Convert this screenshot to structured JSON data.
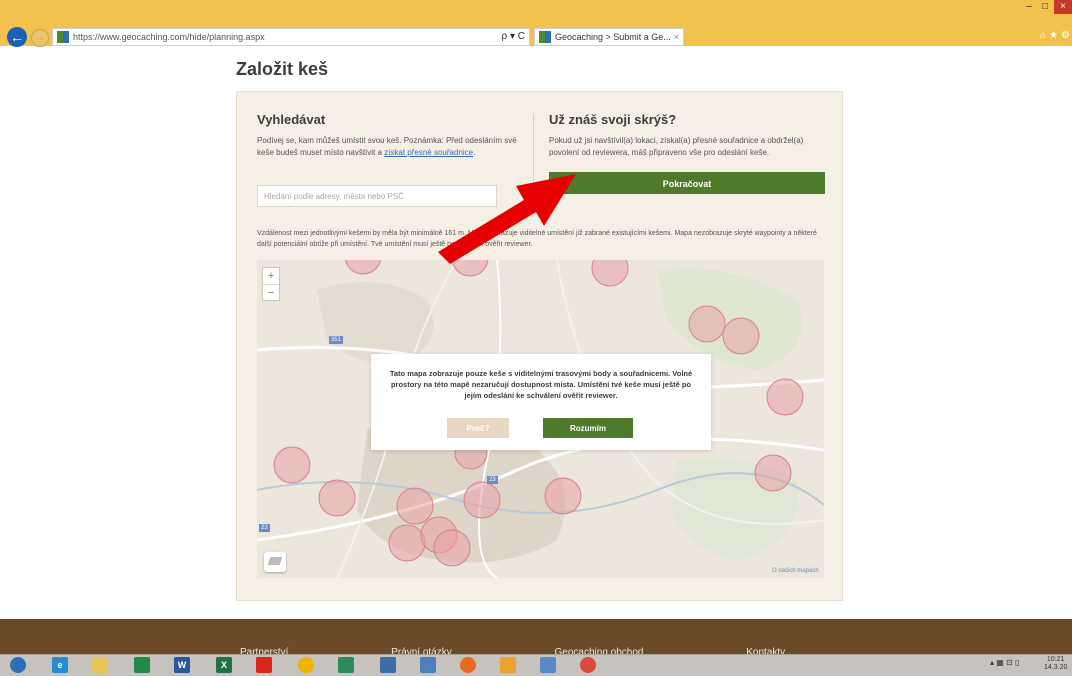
{
  "browser": {
    "url": "https://www.geocaching.com/hide/planning.aspx",
    "tab_title": "Geocaching > Submit a Ge...",
    "tab_close": "×",
    "address_tools": "ρ ▾ C",
    "window_min": "–",
    "window_max": "□",
    "window_close": "×"
  },
  "page": {
    "title": "Založit keš"
  },
  "left_column": {
    "heading": "Vyhledávat",
    "text_before_link": "Podívej se, kam můžeš umístit svou keš. Poznámka: Před odesláním své keše budeš muset místo navštívit a ",
    "link": "získat přesné souřadnice",
    "text_after_link": ".",
    "search_placeholder": "Hledání podle adresy, města nebo PSČ"
  },
  "right_column": {
    "heading": "Už znáš svoji skrýš?",
    "text": "Pokud už jsi navštívil(a) lokaci, získal(a) přesné souřadnice a obdržel(a) povolení od reviewera, máš připraveno vše pro odeslání keše.",
    "continue_label": "Pokračovat"
  },
  "notice": "Vzdálenost mezi jednotlivými kešemi by měla být minimálně 161 m. Mapa zobrazuje viditelné umístění již zabrané existujícími kešemi. Mapa nezobrazuje skryté waypointy a některé další potenciální obtíže při umístění. Tvé umístění musí ještě po odeslání ověřit reviewer.",
  "map": {
    "zoom_in": "+",
    "zoom_out": "−",
    "credit": "O našich mapách",
    "road_labels": [
      "351",
      "23",
      "23"
    ],
    "modal": {
      "text": "Tato mapa zobrazuje pouze keše s viditelnými trasovými body a souřadnicemi. Volné prostory na této mapě nezaručují dostupnost místa. Umístění tvé keše musí ještě po jejím odeslání ke schválení ověřit reviewer.",
      "why_label": "Proč?",
      "ok_label": "Rozumím"
    }
  },
  "footer": {
    "links": [
      "Partnerství",
      "Právní otázky",
      "Geocaching obchod",
      "Kontakty"
    ]
  },
  "taskbar": {
    "time": "10:21",
    "date": "14.3.20"
  },
  "colors": {
    "primary_green": "#4f7a2c",
    "panel_bg": "#f6efe6",
    "cache_circle": "#e8a0a6",
    "footer_brown": "#6b4a2a",
    "annotation_red": "#e60000"
  }
}
